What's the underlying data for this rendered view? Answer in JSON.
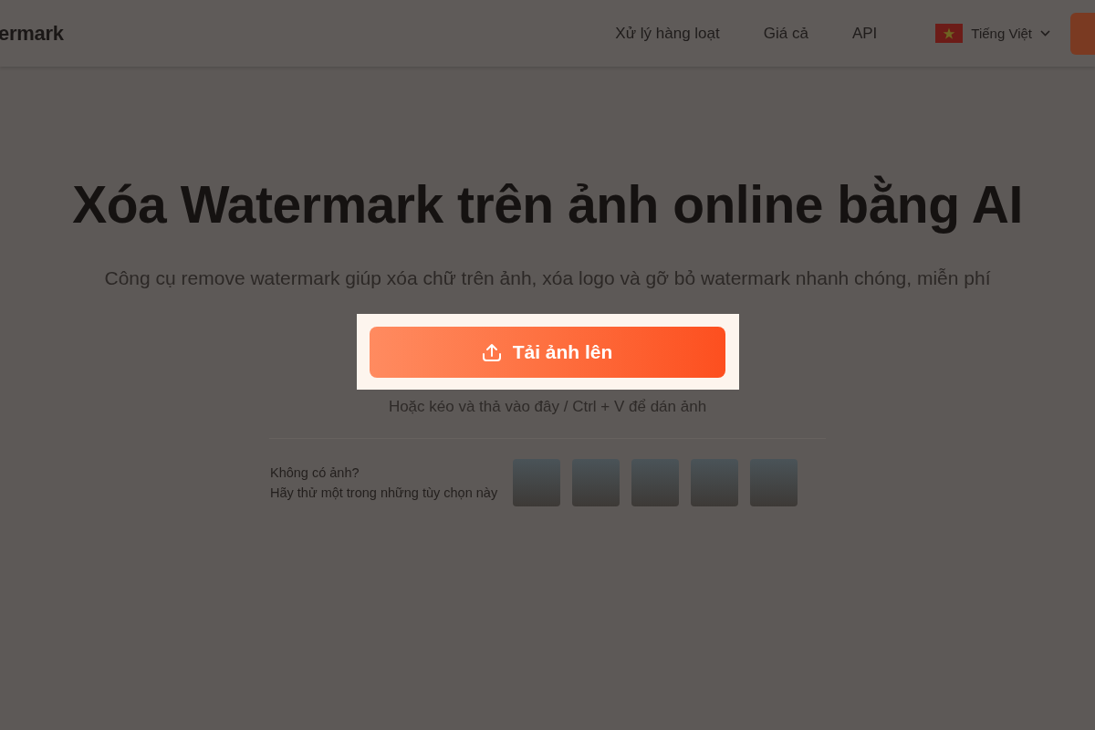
{
  "header": {
    "logo": "ermark",
    "nav": [
      {
        "label": "Xử lý hàng loạt"
      },
      {
        "label": "Giá cả"
      },
      {
        "label": "API"
      }
    ],
    "language": "Tiếng Việt",
    "action_button": {
      "kind": "cut"
    }
  },
  "hero": {
    "title": "Xóa Watermark trên ảnh online bằng AI",
    "subtitle": "Công cụ remove watermark giúp xóa chữ trên ảnh, xóa logo và gỡ bỏ watermark nhanh chóng, miễn phí",
    "upload_button": "Tải ảnh lên",
    "hint": "Hoặc kéo và thả vào đây / Ctrl + V để dán ảnh"
  },
  "samples": {
    "line_1": "Không có ảnh?",
    "line_2": "Hãy thử một trong những tùy chọn này",
    "images": [
      {
        "kind": "photo"
      },
      {
        "kind": "photo"
      },
      {
        "kind": "photo"
      },
      {
        "kind": "photo"
      },
      {
        "kind": "photo"
      }
    ]
  }
}
